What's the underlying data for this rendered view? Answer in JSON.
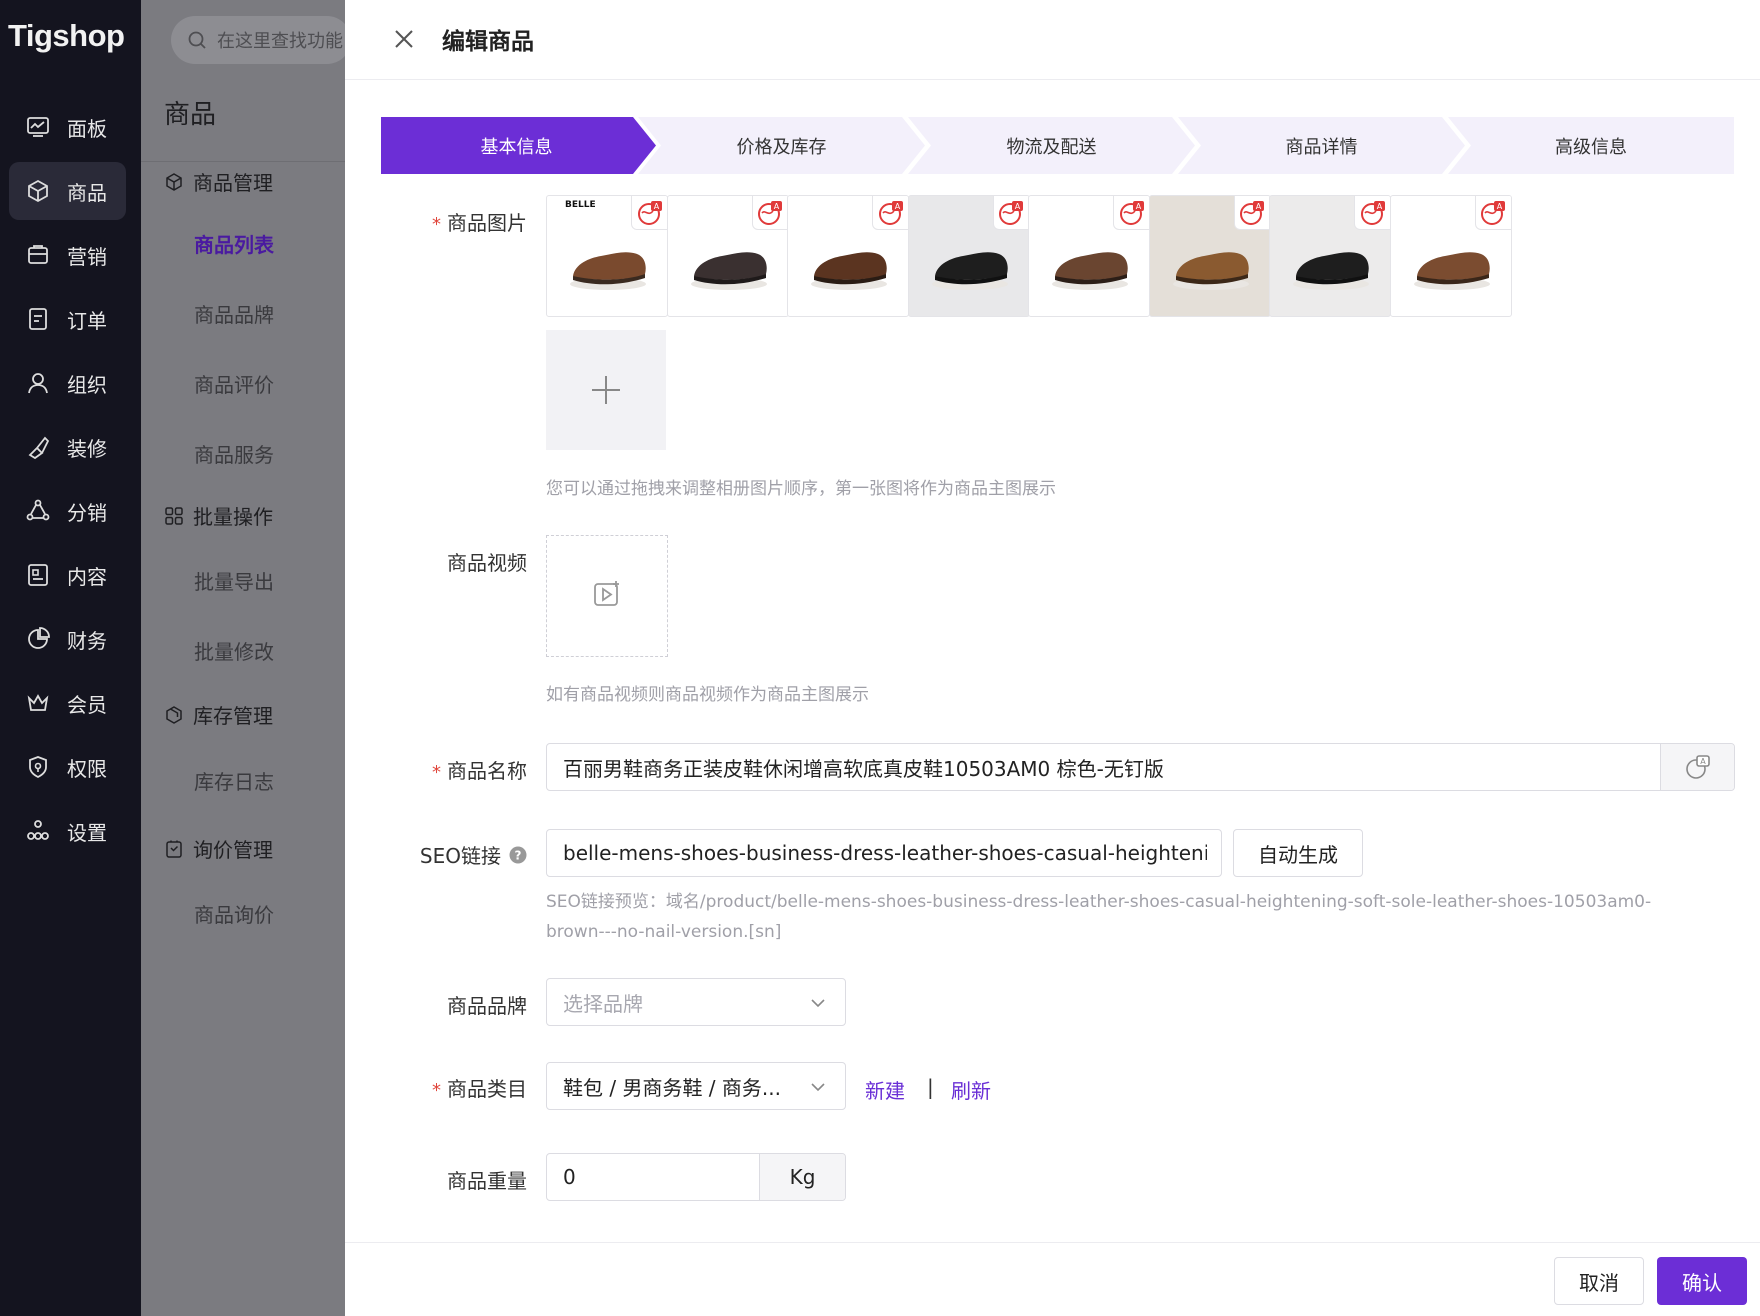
{
  "app": {
    "logo": "Tigshop"
  },
  "rail": {
    "items": [
      {
        "label": "面板",
        "icon": "dashboard-icon"
      },
      {
        "label": "商品",
        "icon": "box-icon"
      },
      {
        "label": "营销",
        "icon": "marketing-icon"
      },
      {
        "label": "订单",
        "icon": "order-icon"
      },
      {
        "label": "组织",
        "icon": "user-icon"
      },
      {
        "label": "装修",
        "icon": "brush-icon"
      },
      {
        "label": "分销",
        "icon": "share-icon"
      },
      {
        "label": "内容",
        "icon": "content-icon"
      },
      {
        "label": "财务",
        "icon": "pie-icon"
      },
      {
        "label": "会员",
        "icon": "crown-icon"
      },
      {
        "label": "权限",
        "icon": "shield-icon"
      },
      {
        "label": "设置",
        "icon": "settings-icon"
      }
    ],
    "active": "商品"
  },
  "subnav": {
    "search_placeholder": "在这里查找功能",
    "title": "商品",
    "group1": "商品管理",
    "list": "商品列表",
    "brand": "商品品牌",
    "review": "商品评价",
    "service": "商品服务",
    "group2": "批量操作",
    "export": "批量导出",
    "modify": "批量修改",
    "group3": "库存管理",
    "stocklog": "库存日志",
    "group4": "询价管理",
    "inquiry": "商品询价"
  },
  "drawer": {
    "title": "编辑商品",
    "steps": [
      "基本信息",
      "价格及库存",
      "物流及配送",
      "商品详情",
      "高级信息"
    ],
    "active_step": "基本信息",
    "images_label": "商品图片",
    "images_count": 8,
    "images_hint": "您可以通过拖拽来调整相册图片顺序，第一张图将作为商品主图展示",
    "thumb_brand_text": "BELLE",
    "video_label": "商品视频",
    "video_hint": "如有商品视频则商品视频作为商品主图展示",
    "name_label": "商品名称",
    "name_value": "百丽男鞋商务正装皮鞋休闲增高软底真皮鞋10503AM0 棕色-无钉版",
    "seo_label": "SEO链接",
    "seo_value": "belle-mens-shoes-business-dress-leather-shoes-casual-heightening-soft-sole-leather-shoes-10503am0-brown---no-nail-version",
    "seo_generate": "自动生成",
    "seo_preview_line1": "SEO链接预览：域名/product/belle-mens-shoes-business-dress-leather-shoes-casual-heightening-soft-sole-leather-shoes-10503am0-",
    "seo_preview_line2": "brown---no-nail-version.[sn]",
    "brand_label": "商品品牌",
    "brand_placeholder": "选择品牌",
    "category_label": "商品类目",
    "category_value": "鞋包 / 男商务鞋 / 商务...",
    "category_new": "新建",
    "category_sep": "|",
    "category_refresh": "刷新",
    "weight_label": "商品重量",
    "weight_value": "0",
    "weight_unit": "Kg",
    "cancel": "取消",
    "confirm": "确认"
  },
  "colors": {
    "accent": "#6c2ed6",
    "step_inactive": "#f3f0fb",
    "required": "#e0453b"
  }
}
